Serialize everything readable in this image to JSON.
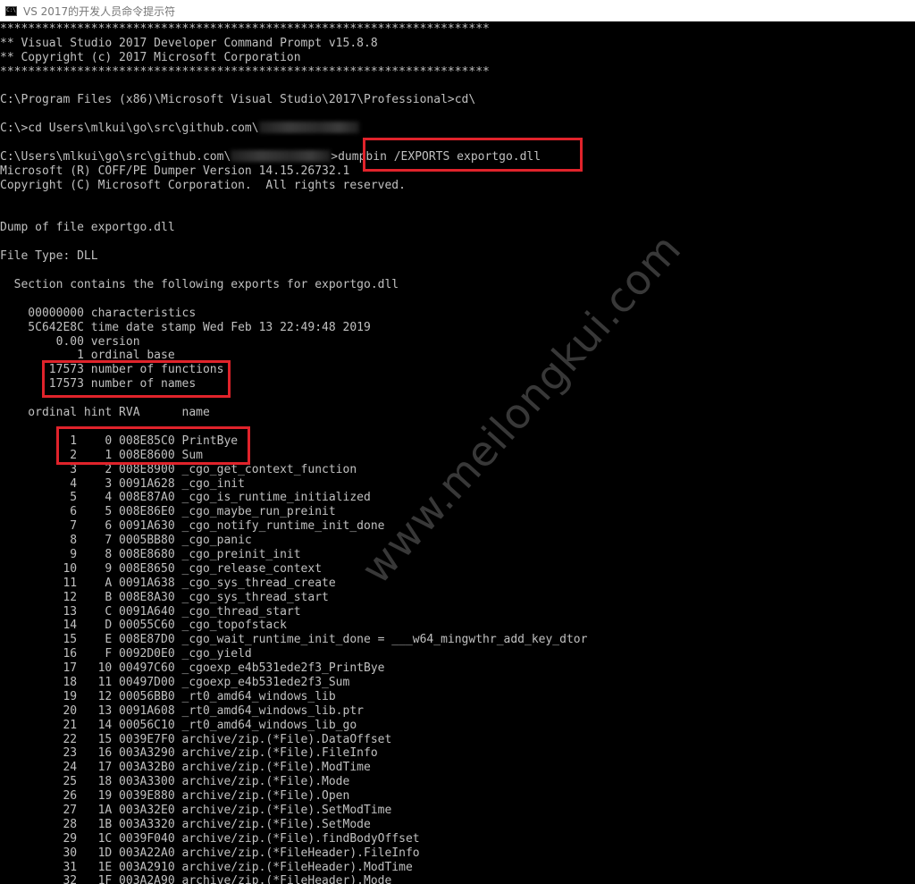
{
  "window": {
    "title": "VS 2017的开发人员命令提示符",
    "icon": "console-icon",
    "icon_text": "C:\\"
  },
  "console": {
    "lines": [
      "**********************************************************************",
      "** Visual Studio 2017 Developer Command Prompt v15.8.8",
      "** Copyright (c) 2017 Microsoft Corporation",
      "**********************************************************************",
      "",
      "C:\\Program Files (x86)\\Microsoft Visual Studio\\2017\\Professional>cd\\",
      "",
      "C:\\>cd Users\\mlkui\\go\\src\\github.com\\",
      "",
      "C:\\Users\\mlkui\\go\\src\\github.com\\",
      "Microsoft (R) COFF/PE Dumper Version 14.15.26732.1",
      "Copyright (C) Microsoft Corporation.  All rights reserved.",
      "",
      "",
      "Dump of file exportgo.dll",
      "",
      "File Type: DLL",
      "",
      "  Section contains the following exports for exportgo.dll",
      "",
      "    00000000 characteristics",
      "    5C642E8C time date stamp Wed Feb 13 22:49:48 2019",
      "        0.00 version",
      "           1 ordinal base",
      "       17573 number of functions",
      "       17573 number of names",
      "",
      "    ordinal hint RVA      name",
      "",
      "          1    0 008E85C0 PrintBye",
      "          2    1 008E8600 Sum",
      "          3    2 008E8900 _cgo_get_context_function",
      "          4    3 0091A628 _cgo_init",
      "          5    4 008E87A0 _cgo_is_runtime_initialized",
      "          6    5 008E86E0 _cgo_maybe_run_preinit",
      "          7    6 0091A630 _cgo_notify_runtime_init_done",
      "          8    7 0005BB80 _cgo_panic",
      "          9    8 008E8680 _cgo_preinit_init",
      "         10    9 008E8650 _cgo_release_context",
      "         11    A 0091A638 _cgo_sys_thread_create",
      "         12    B 008E8A30 _cgo_sys_thread_start",
      "         13    C 0091A640 _cgo_thread_start",
      "         14    D 00055C60 _cgo_topofstack",
      "         15    E 008E87D0 _cgo_wait_runtime_init_done = ___w64_mingwthr_add_key_dtor",
      "         16    F 0092D0E0 _cgo_yield",
      "         17   10 00497C60 _cgoexp_e4b531ede2f3_PrintBye",
      "         18   11 00497D00 _cgoexp_e4b531ede2f3_Sum",
      "         19   12 00056BB0 _rt0_amd64_windows_lib",
      "         20   13 0091A608 _rt0_amd64_windows_lib.ptr",
      "         21   14 00056C10 _rt0_amd64_windows_lib_go",
      "         22   15 0039E7F0 archive/zip.(*File).DataOffset",
      "         23   16 003A3290 archive/zip.(*File).FileInfo",
      "         24   17 003A32B0 archive/zip.(*File).ModTime",
      "         25   18 003A3300 archive/zip.(*File).Mode",
      "         26   19 0039E880 archive/zip.(*File).Open",
      "         27   1A 003A32E0 archive/zip.(*File).SetModTime",
      "         28   1B 003A3320 archive/zip.(*File).SetMode",
      "         29   1C 0039F040 archive/zip.(*File).findBodyOffset",
      "         30   1D 003A22A0 archive/zip.(*FileHeader).FileInfo",
      "         31   1E 003A2910 archive/zip.(*FileHeader).ModTime",
      "         32   1F 003A2A90 archive/zip.(*FileHeader).Mode"
    ],
    "command_after_redaction": ">dumpbin /EXPORTS exportgo.dll"
  },
  "watermark": "www.meilongkui.com",
  "colors": {
    "background": "#000000",
    "text": "#c0c0c0",
    "highlight_box": "#e0232b",
    "title_bar": "#ffffff"
  }
}
